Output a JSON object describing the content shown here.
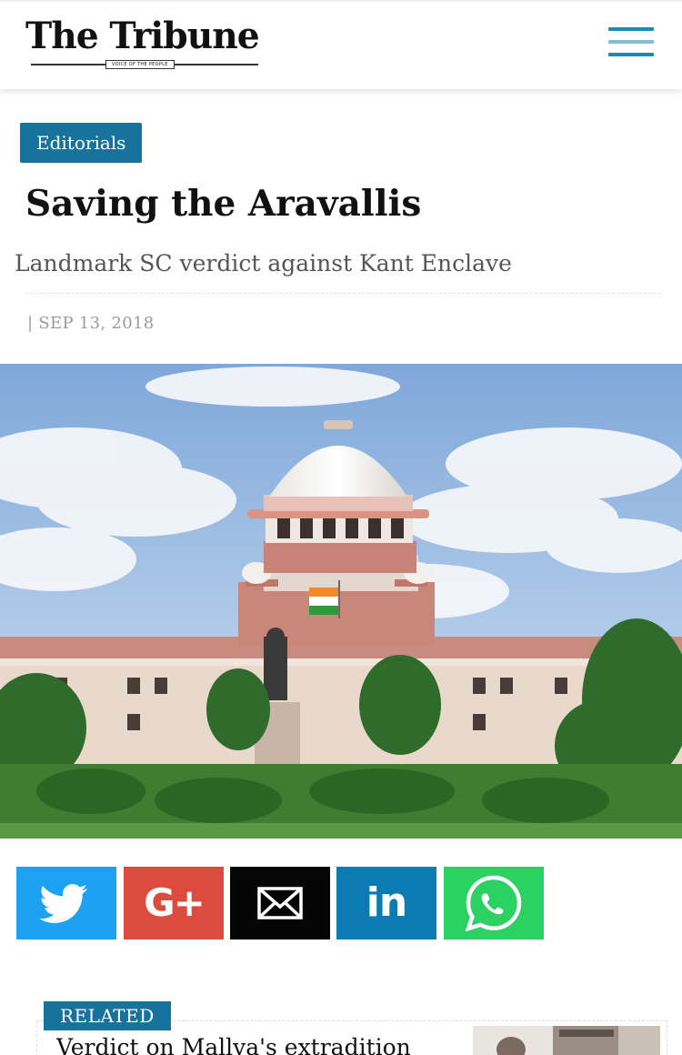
{
  "header": {
    "logo_text": "The Tribune",
    "logo_tagline": "VOICE OF THE PEOPLE",
    "menu_icon": "hamburger-menu-icon",
    "colors": {
      "menu_dark": "#1a8bb6",
      "menu_light": "#7fbfd6"
    }
  },
  "article": {
    "category": "Editorials",
    "title": "Saving the Aravallis",
    "subtitle": "Landmark SC verdict against Kant Enclave",
    "date_separator": "|",
    "date": "SEP 13, 2018",
    "image_subject": "supreme-court-building-photo"
  },
  "share": [
    {
      "name": "twitter",
      "icon": "twitter-bird-icon",
      "color": "#1da1f2"
    },
    {
      "name": "google-plus",
      "label": "G+",
      "icon": "google-plus-icon",
      "color": "#dc4c3e"
    },
    {
      "name": "email",
      "icon": "envelope-icon",
      "color": "#050505"
    },
    {
      "name": "linkedin",
      "label": "in",
      "icon": "linkedin-icon",
      "color": "#0c7ab3"
    },
    {
      "name": "whatsapp",
      "icon": "whatsapp-icon",
      "color": "#2bd163"
    }
  ],
  "related": {
    "label": "RELATED",
    "headline": "Verdict on Mallya's extradition",
    "thumb_icon": "related-thumbnail-photo"
  },
  "colors": {
    "accent": "#17729c"
  }
}
